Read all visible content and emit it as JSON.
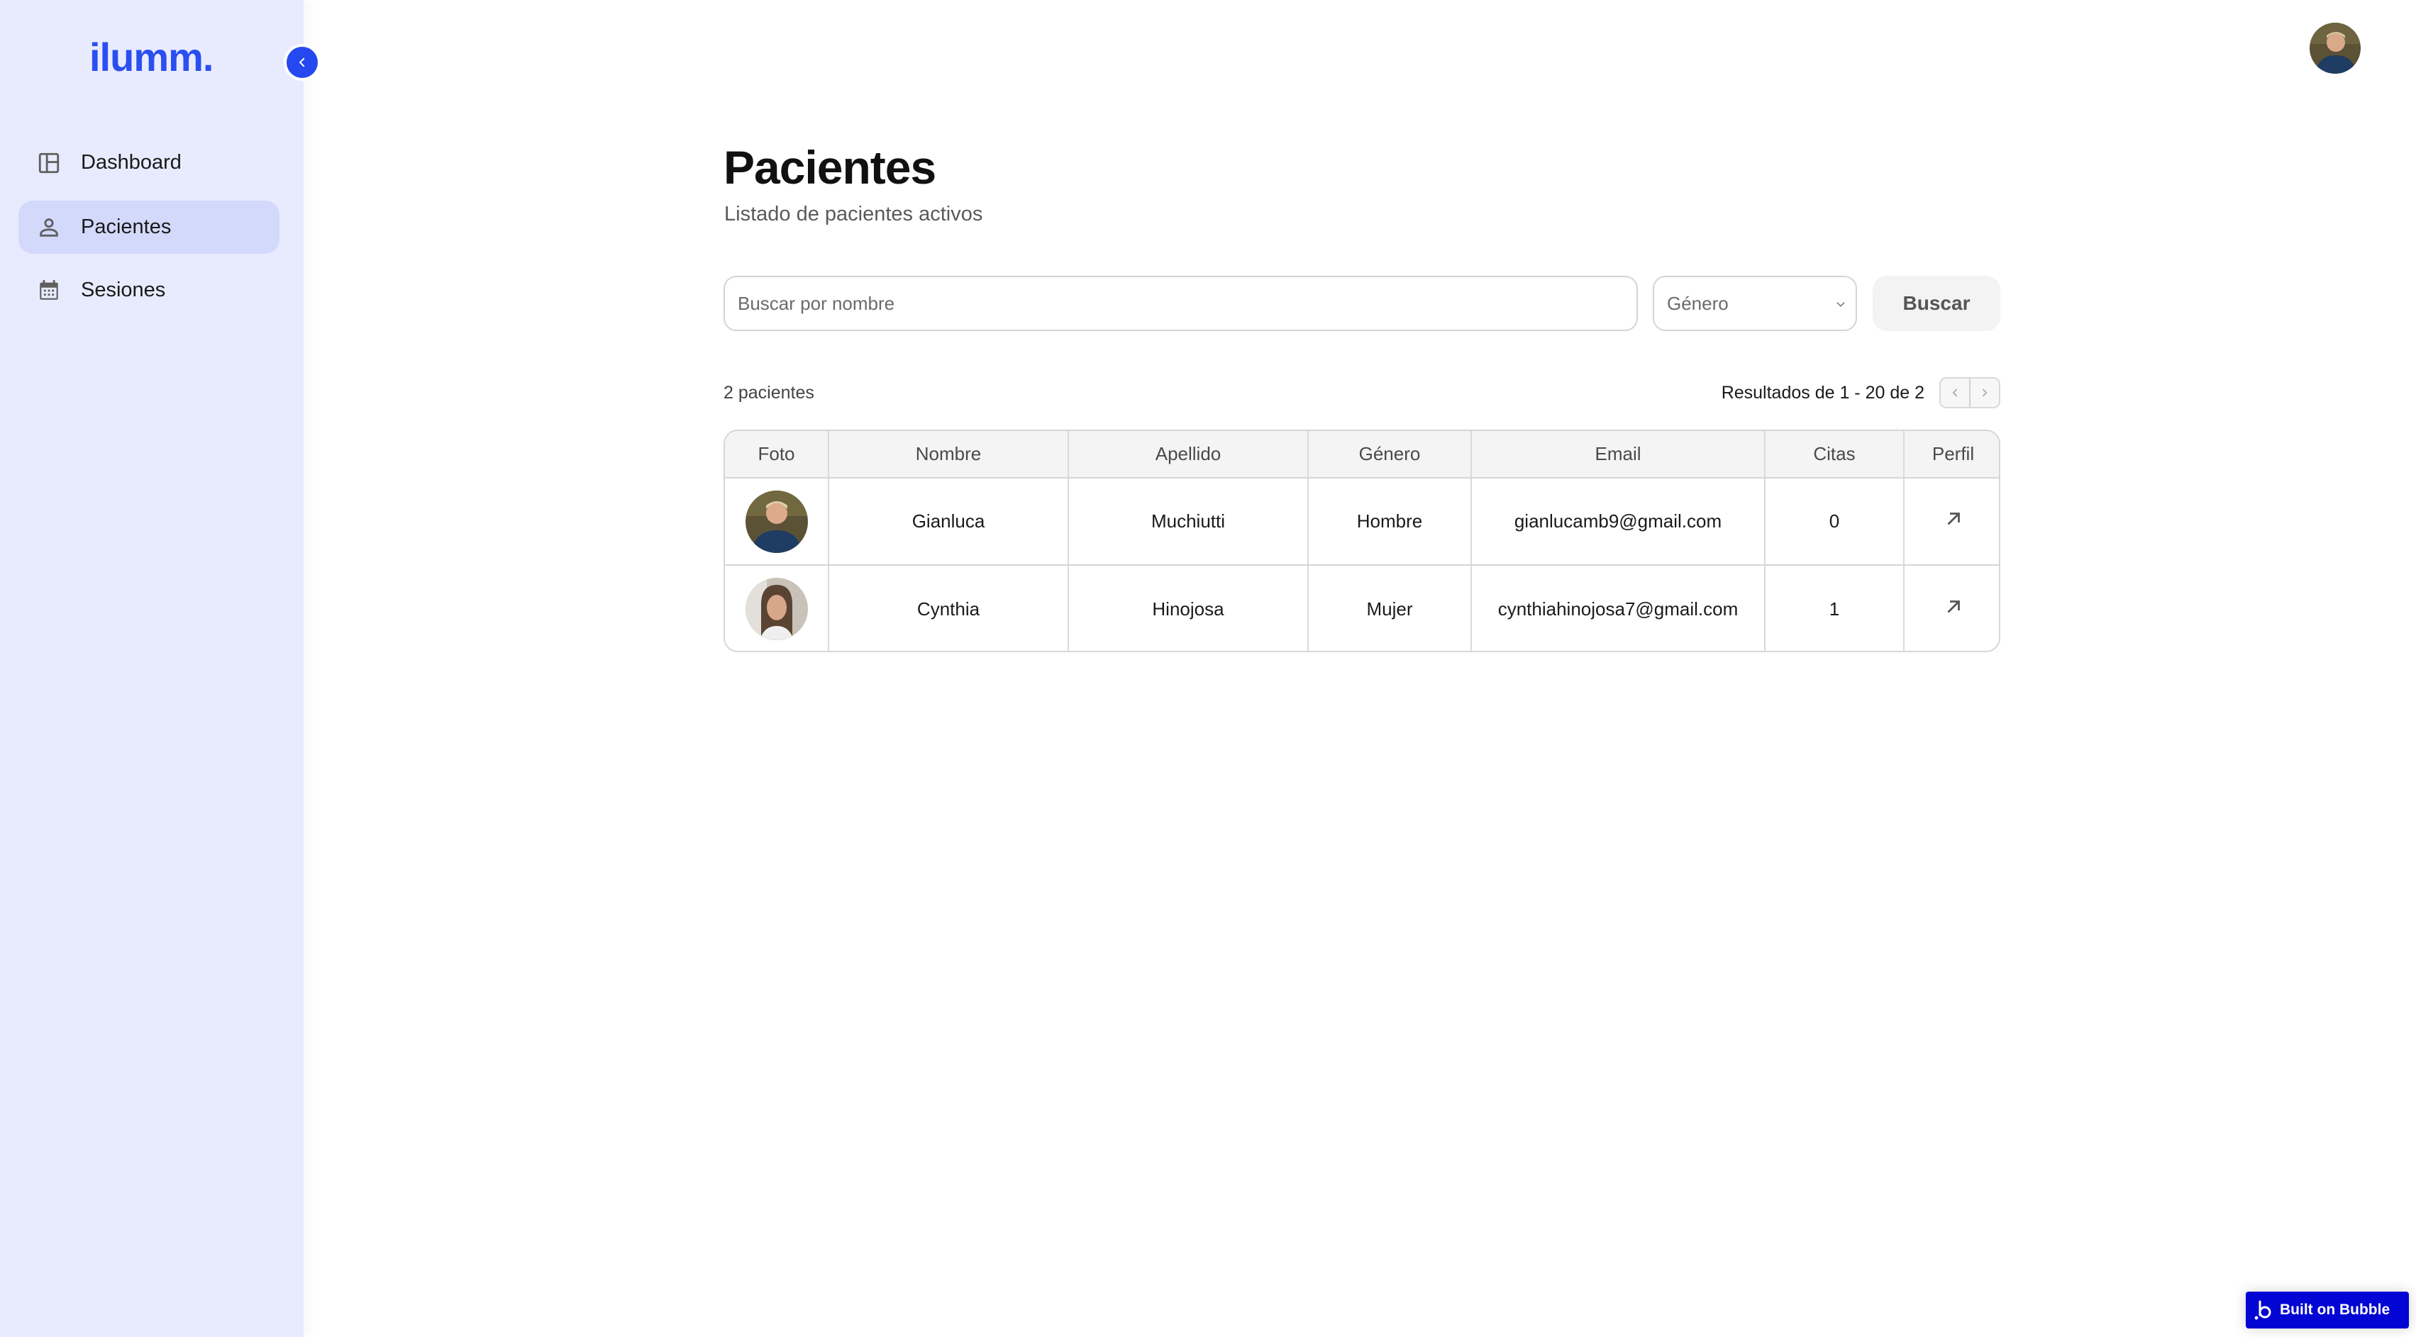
{
  "app": {
    "logo_text": "ilumm.",
    "brand_color": "#2548f0"
  },
  "sidebar": {
    "collapse_icon": "chevron-left-icon",
    "items": [
      {
        "label": "Dashboard",
        "icon": "dashboard-layout-icon",
        "active": false
      },
      {
        "label": "Pacientes",
        "icon": "person-icon",
        "active": true
      },
      {
        "label": "Sesiones",
        "icon": "calendar-icon",
        "active": false
      }
    ]
  },
  "header": {
    "avatar": "user-avatar"
  },
  "main": {
    "title": "Pacientes",
    "subtitle": "Listado de pacientes activos",
    "search": {
      "placeholder": "Buscar por nombre",
      "value": ""
    },
    "gender_select": {
      "selected": "Género"
    },
    "search_button": "Buscar",
    "count_label": "2 pacientes",
    "results_label": "Resultados de 1 - 20 de 2"
  },
  "table": {
    "columns": [
      "Foto",
      "Nombre",
      "Apellido",
      "Género",
      "Email",
      "Citas",
      "Perfil"
    ],
    "rows": [
      {
        "nombre": "Gianluca",
        "apellido": "Muchiutti",
        "genero": "Hombre",
        "email": "gianlucamb9@gmail.com",
        "citas": "0",
        "perfil_icon": "arrow-up-right-icon"
      },
      {
        "nombre": "Cynthia",
        "apellido": "Hinojosa",
        "genero": "Mujer",
        "email": "cynthiahinojosa7@gmail.com",
        "citas": "1",
        "perfil_icon": "arrow-up-right-icon"
      }
    ]
  },
  "footer_badge": {
    "label": "Built on Bubble",
    "color": "#0205d3"
  }
}
